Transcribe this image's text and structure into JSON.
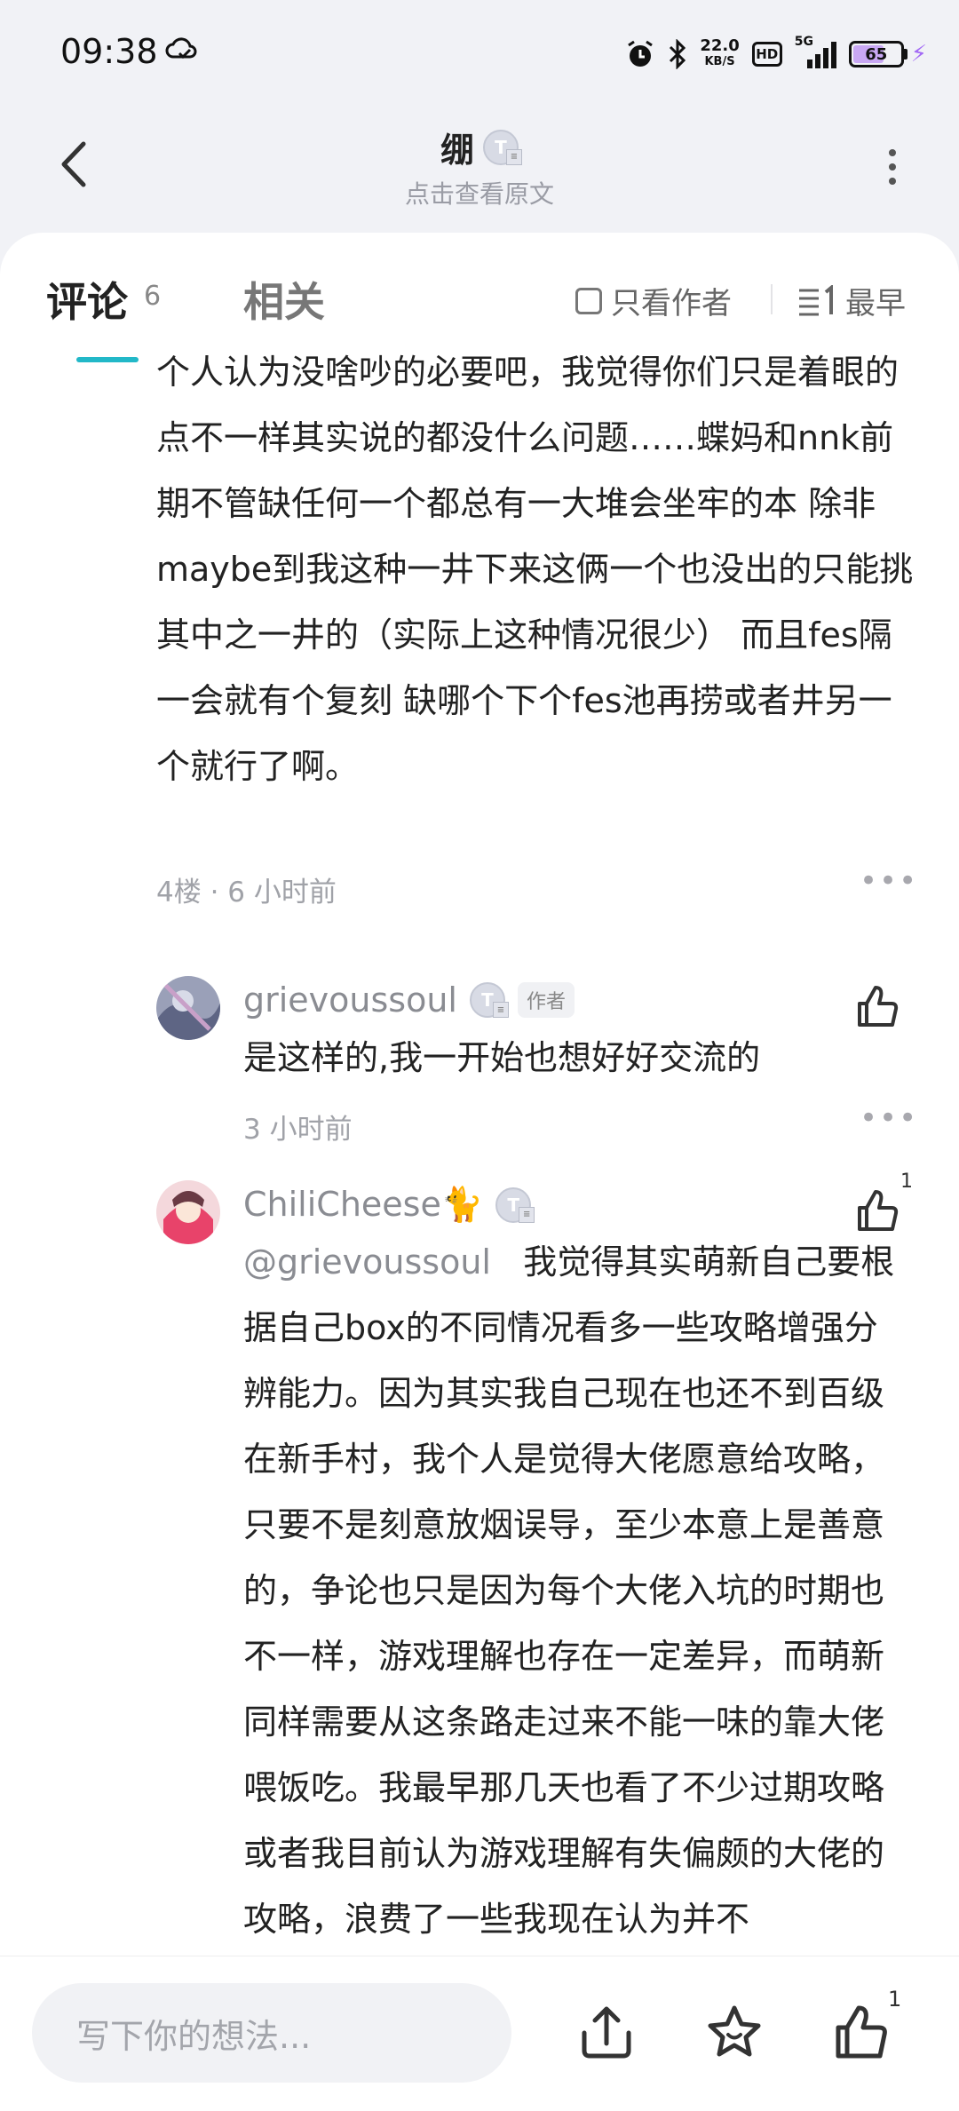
{
  "status_bar": {
    "time": "09:38",
    "net_speed_value": "22.0",
    "net_speed_unit": "KB/S",
    "hd_label": "HD",
    "network_label": "5G",
    "battery_level": "65"
  },
  "header": {
    "title": "绷",
    "subtitle": "点击查看原文"
  },
  "tabs": {
    "comments_label": "评论",
    "comments_count": "6",
    "related_label": "相关",
    "author_only_label": "只看作者",
    "sort_label": "最早"
  },
  "comment": {
    "text": "个人认为没啥吵的必要吧，我觉得你们只是着眼的点不一样其实说的都没什么问题……蝶妈和nnk前期不管缺任何一个都总有一大堆会坐牢的本 除非maybe到我这种一井下来这俩一个也没出的只能挑其中之一井的（实际上这种情况很少） 而且fes隔一会就有个复刻 缺哪个下个fes池再捞或者井另一个就行了啊。",
    "meta": "4楼 · 6 小时前"
  },
  "replies": [
    {
      "username": "grievoussoul",
      "author_tag": "作者",
      "text": "是这样的,我一开始也想好好交流的",
      "time": "3 小时前",
      "likes": ""
    },
    {
      "username": "ChiliCheese🐈",
      "mention": "@grievoussoul",
      "text": "我觉得其实萌新自己要根据自己box的不同情况看多一些攻略增强分辨能力。因为其实我自己现在也还不到百级在新手村，我个人是觉得大佬愿意给攻略，只要不是刻意放烟误导，至少本意上是善意的，争论也只是因为每个大佬入坑的时期也不一样，游戏理解也存在一定差异，而萌新同样需要从这条路走过来不能一味的靠大佬喂饭吃。我最早那几天也看了不少过期攻略或者我目前认为游戏理解有失偏颇的大佬的攻略，浪费了一些我现在认为并不",
      "likes": "1"
    }
  ],
  "bottom_bar": {
    "input_placeholder": "写下你的想法...",
    "like_count": "1"
  },
  "colors": {
    "accent": "#22b8c8",
    "battery_fill": "#c9a8f4",
    "bolt": "#a36af5"
  }
}
